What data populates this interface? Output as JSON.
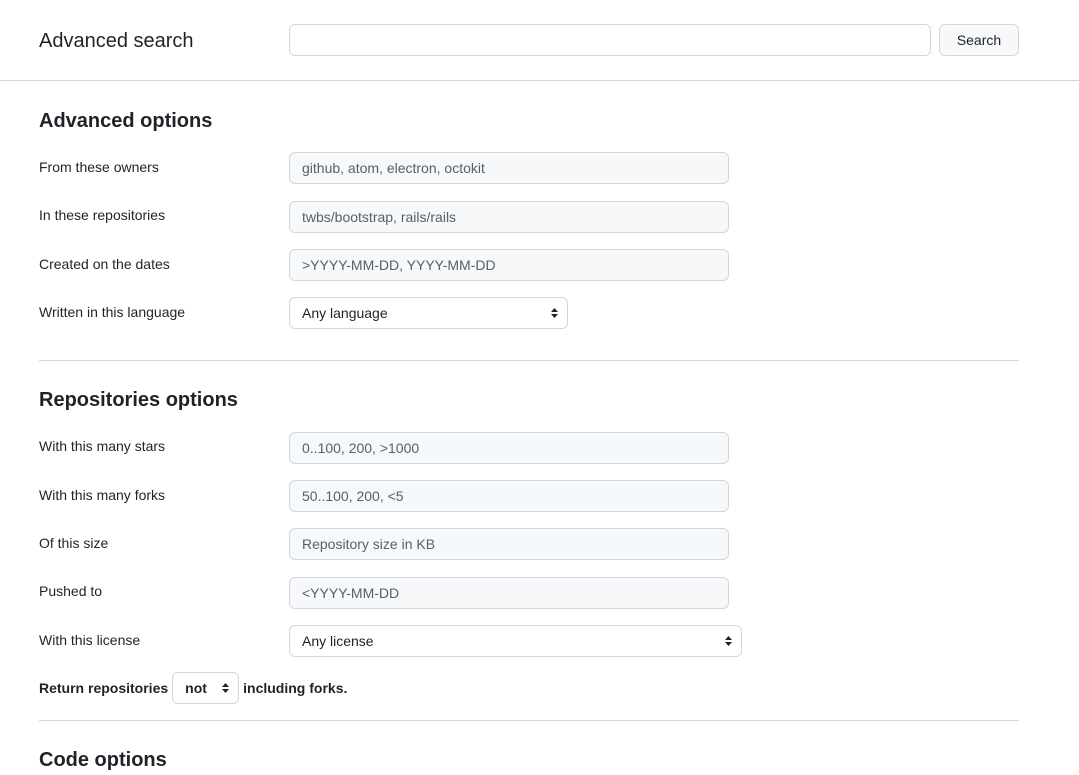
{
  "header": {
    "title": "Advanced search",
    "search_value": "",
    "search_button": "Search"
  },
  "advanced": {
    "title": "Advanced options",
    "owners_label": "From these owners",
    "owners_placeholder": "github, atom, electron, octokit",
    "repos_label": "In these repositories",
    "repos_placeholder": "twbs/bootstrap, rails/rails",
    "dates_label": "Created on the dates",
    "dates_placeholder": ">YYYY-MM-DD, YYYY-MM-DD",
    "language_label": "Written in this language",
    "language_selected": "Any language"
  },
  "repositories": {
    "title": "Repositories options",
    "stars_label": "With this many stars",
    "stars_placeholder": "0..100, 200, >1000",
    "forks_label": "With this many forks",
    "forks_placeholder": "50..100, 200, <5",
    "size_label": "Of this size",
    "size_placeholder": "Repository size in KB",
    "pushed_label": "Pushed to",
    "pushed_placeholder": "<YYYY-MM-DD",
    "license_label": "With this license",
    "license_selected": "Any license",
    "return_prefix": "Return repositories",
    "forks_selected": "not",
    "return_suffix": "including forks."
  },
  "code": {
    "title": "Code options"
  },
  "icons": {
    "select_arrows": "select-arrows-icon"
  }
}
